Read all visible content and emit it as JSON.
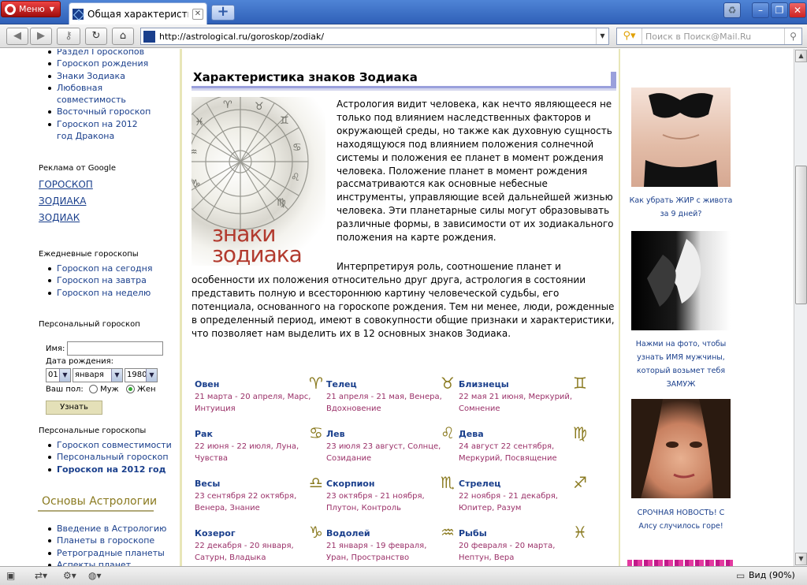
{
  "browser": {
    "menu_label": "Меню",
    "tab_title": "Общая характеристик...",
    "url": "http://astrological.ru/goroskop/zodiak/",
    "search_placeholder": "Поиск в Поиск@Mail.Ru",
    "zoom": "Вид (90%)"
  },
  "sidebar": {
    "top_links": [
      "Раздел Гороскопов",
      "Гороскоп рождения",
      "Знаки Зодиака",
      "Любовная совместимость",
      "Восточный гороскоп",
      "Гороскоп на 2012 год Дракона"
    ],
    "ads_title": "Реклама от Google",
    "ads": [
      "ГОРОСКОП",
      "ЗОДИАКА",
      "ЗОДИАК"
    ],
    "daily_title": "Ежедневные гороскопы",
    "daily": [
      "Гороскоп на сегодня",
      "Гороскоп на завтра",
      "Гороскоп на неделю"
    ],
    "personal_title": "Персональный гороскоп",
    "name_label": "Имя:",
    "birth_label": "Дата рождения:",
    "day": "01",
    "month": "января",
    "year": "1980",
    "gender_label": "Ваш пол:",
    "male": "Муж",
    "female": "Жен",
    "find_button": "Узнать",
    "personal_list_title": "Персональные гороскопы",
    "personal_list": [
      "Гороскоп совместимости",
      "Персональный гороскоп",
      "Гороскоп на 2012 год"
    ],
    "osnovy_title": "Основы Астрологии",
    "osnovy": [
      "Введение в Астрологию",
      "Планеты в гороскопе",
      "Ретроградные планеты",
      "Аспекты планет"
    ]
  },
  "main": {
    "title": "Характеристика знаков Зодиака",
    "image_text_1": "знаки",
    "image_text_2": "зодиака",
    "paragraph_1": "Астрология видит человека, как нечто являющееся не только под влиянием наследственных факторов и окружающей среды, но также как духовную сущность находящуюся под влиянием положения солнечной системы и положения ее планет в момент рождения человека. Положение планет в момент рождения рассматриваются как основные небесные инструменты, управляющие всей дальнейшей жизнью человека. Эти планетарные силы могут образовывать различные формы, в зависимости от их зодиакального положения на карте рождения.",
    "paragraph_2": "Интерпретируя роль, соотношение планет и особенности их положения относительно друг друга, астрология в состоянии представить полную и всестороннюю картину человеческой судьбы, его потенциала, основанного на гороскопе рождения. Тем ни менее, люди, рожденные в определенный период, имеют в совокупности общие признаки и характеристики, что позволяет нам выделить их в 12 основных знаков Зодиака.",
    "signs": [
      {
        "name": "Овен",
        "dates": "21 марта - 20 апреля, Марс,",
        "traits": "Интуиция",
        "glyph": "♈"
      },
      {
        "name": "Телец",
        "dates": "21 апреля - 21 мая, Венера,",
        "traits": "Вдохновение",
        "glyph": "♉"
      },
      {
        "name": "Близнецы",
        "dates": "22 мая 21 июня, Меркурий,",
        "traits": "Сомнение",
        "glyph": "♊"
      },
      {
        "name": "Рак",
        "dates": "22 июня - 22 июля, Луна,",
        "traits": "Чувства",
        "glyph": "♋"
      },
      {
        "name": "Лев",
        "dates": "23 июля 23 август, Солнце,",
        "traits": "Созидание",
        "glyph": "♌"
      },
      {
        "name": "Дева",
        "dates": "24 август 22 сентября,",
        "traits": "Меркурий, Посвящение",
        "glyph": "♍"
      },
      {
        "name": "Весы",
        "dates": "23 сентября 22 октября,",
        "traits": "Венера, Знание",
        "glyph": "♎"
      },
      {
        "name": "Скорпион",
        "dates": "23 октября - 21 ноября,",
        "traits": "Плутон, Контроль",
        "glyph": "♏"
      },
      {
        "name": "Стрелец",
        "dates": "22 ноября - 21 декабря,",
        "traits": "Юпитер, Разум",
        "glyph": "♐"
      },
      {
        "name": "Козерог",
        "dates": "22 декабря - 20 января,",
        "traits": "Сатурн, Владыка",
        "glyph": "♑"
      },
      {
        "name": "Водолей",
        "dates": "21 января - 19 февраля,",
        "traits": "Уран, Пространство",
        "glyph": "♒"
      },
      {
        "name": "Рыбы",
        "dates": "20 февраля - 20 марта,",
        "traits": "Нептун, Вера",
        "glyph": "♓"
      }
    ]
  },
  "ads_right": [
    {
      "text": "Как убрать ЖИР с живота за 9 дней?"
    },
    {
      "text": "Нажми на фото, чтобы узнать ИМЯ мужчины, который возьмет тебя ЗАМУЖ"
    },
    {
      "text": "СРОЧНАЯ НОВОСТЬ! С Алсу случилось горе!"
    }
  ]
}
